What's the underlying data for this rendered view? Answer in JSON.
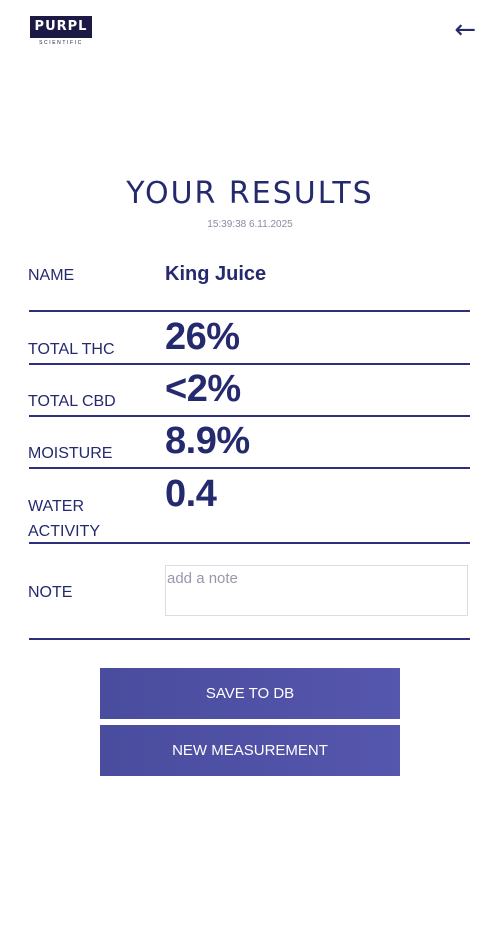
{
  "header": {
    "logo_text": "PURPL",
    "logo_subtext": "SCIENTIFIC",
    "back_icon": "arrow-left-icon"
  },
  "results": {
    "title": "YOUR RESULTS",
    "timestamp": "15:39:38 6.11.2025"
  },
  "fields": {
    "name_label": "NAME",
    "name_value": "King Juice",
    "thc_label": "TOTAL THC",
    "thc_value": "26%",
    "cbd_label": "TOTAL CBD",
    "cbd_value": "<2%",
    "moisture_label": "MOISTURE",
    "moisture_value": "8.9%",
    "water_label_line1": "WATER",
    "water_label_line2": "ACTIVITY",
    "water_value": "0.4",
    "note_label": "NOTE",
    "note_placeholder": "add a note"
  },
  "actions": {
    "save_label": "SAVE TO DB",
    "new_label": "NEW MEASUREMENT"
  },
  "colors": {
    "accent": "#25296e",
    "button": "#4f51a5"
  }
}
